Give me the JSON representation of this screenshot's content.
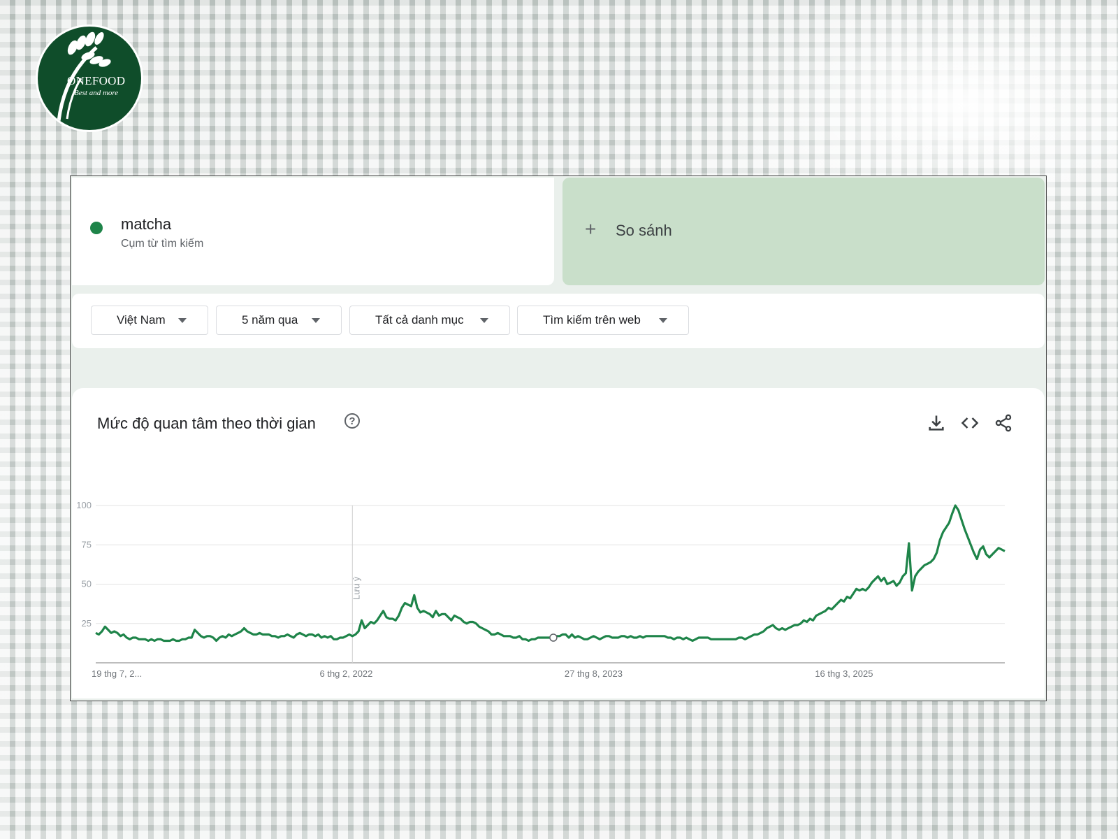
{
  "brand": {
    "name": "ONEFOOD",
    "tagline": "Best and more"
  },
  "search_term": {
    "label": "matcha",
    "type": "Cụm từ tìm kiếm",
    "color": "#1e8449"
  },
  "compare": {
    "label": "So sánh"
  },
  "filters": [
    {
      "label": "Việt Nam"
    },
    {
      "label": "5 năm qua"
    },
    {
      "label": "Tất cả danh mục"
    },
    {
      "label": "Tìm kiếm trên web"
    }
  ],
  "chart": {
    "title": "Mức độ quan tâm theo thời gian",
    "icons": [
      "help-icon",
      "download-icon",
      "embed-icon",
      "share-icon"
    ]
  },
  "chart_data": {
    "type": "line",
    "series": [
      {
        "name": "matcha",
        "color": "#1e8449"
      }
    ],
    "ylim": [
      0,
      100
    ],
    "y_ticks": [
      "100",
      "75",
      "50",
      "25"
    ],
    "x_tick_labels": [
      "19 thg 7, 2...",
      "6 thg 2, 2022",
      "27 thg 8, 2023",
      "16 thg 3, 2025"
    ],
    "x_tick_index": [
      0,
      81,
      161,
      242
    ],
    "annotation": {
      "label": "Lưu ý",
      "index": 83
    },
    "values": [
      19,
      18,
      20,
      23,
      21,
      19,
      20,
      19,
      17,
      18,
      16,
      15,
      16,
      16,
      15,
      15,
      15,
      14,
      15,
      14,
      15,
      15,
      14,
      14,
      14,
      15,
      14,
      14,
      15,
      15,
      16,
      16,
      21,
      19,
      17,
      16,
      17,
      17,
      16,
      14,
      16,
      17,
      16,
      18,
      17,
      18,
      19,
      20,
      22,
      20,
      19,
      18,
      18,
      19,
      18,
      18,
      18,
      17,
      17,
      16,
      17,
      17,
      18,
      17,
      16,
      18,
      19,
      18,
      17,
      18,
      18,
      17,
      18,
      16,
      17,
      16,
      17,
      15,
      15,
      16,
      16,
      17,
      18,
      17,
      18,
      20,
      27,
      22,
      24,
      26,
      25,
      27,
      30,
      33,
      29,
      28,
      28,
      27,
      30,
      35,
      38,
      37,
      36,
      43,
      35,
      32,
      33,
      32,
      31,
      29,
      33,
      30,
      31,
      31,
      29,
      27,
      30,
      29,
      28,
      26,
      25,
      26,
      26,
      25,
      23,
      22,
      21,
      20,
      18,
      18,
      19,
      18,
      17,
      17,
      17,
      16,
      16,
      17,
      15,
      15,
      14,
      15,
      15,
      16,
      16,
      16,
      16,
      16,
      16,
      17,
      17,
      18,
      18,
      16,
      18,
      16,
      17,
      16,
      15,
      15,
      16,
      17,
      16,
      15,
      16,
      17,
      17,
      16,
      16,
      16,
      17,
      17,
      16,
      17,
      16,
      16,
      17,
      16,
      17,
      17,
      17,
      17,
      17,
      17,
      17,
      16,
      16,
      15,
      16,
      16,
      15,
      16,
      15,
      14,
      15,
      16,
      16,
      16,
      16,
      15,
      15,
      15,
      15,
      15,
      15,
      15,
      15,
      15,
      16,
      16,
      15,
      16,
      17,
      18,
      18,
      19,
      20,
      22,
      23,
      24,
      22,
      21,
      22,
      21,
      22,
      23,
      24,
      24,
      25,
      27,
      26,
      28,
      27,
      30,
      31,
      32,
      33,
      35,
      34,
      36,
      38,
      40,
      39,
      42,
      41,
      44,
      47,
      46,
      47,
      46,
      48,
      51,
      53,
      55,
      52,
      54,
      50,
      51,
      52,
      49,
      51,
      55,
      57,
      76,
      46,
      55,
      58,
      60,
      62,
      63,
      64,
      66,
      70,
      78,
      83,
      86,
      89,
      95,
      100,
      97,
      91,
      85,
      80,
      75,
      70,
      66,
      72,
      74,
      69,
      67,
      69,
      71,
      73,
      72,
      71
    ]
  }
}
